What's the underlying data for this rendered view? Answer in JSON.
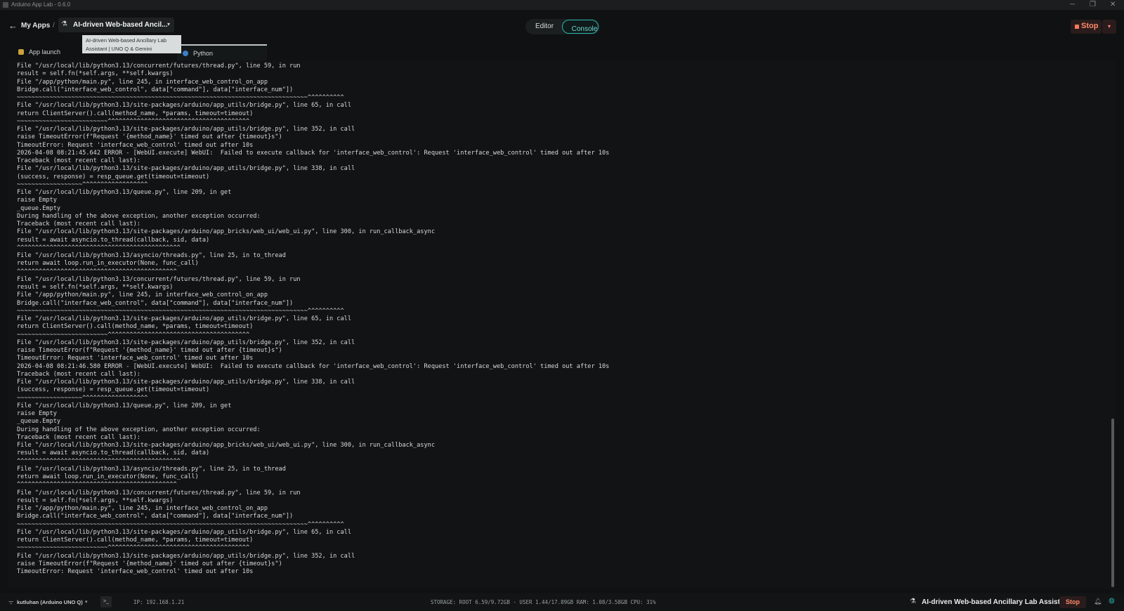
{
  "window": {
    "title": "Arduino App Lab - 0.6.0",
    "controls": [
      "─",
      "❐",
      "✕"
    ]
  },
  "header": {
    "back_icon": "←",
    "my_apps": "My Apps",
    "separator": "/",
    "app_icon": "flask-icon",
    "app_name": "AI-driven Web-based Ancil...",
    "app_caret": "▾",
    "tooltip_line1": "AI-driven Web-based Ancillary Lab",
    "tooltip_line2": "Assistant | UNO Q & Gemini",
    "view_toggle": {
      "editor": "Editor",
      "console": "Console",
      "active": "console"
    },
    "stop_label": "Stop",
    "stop_menu_icon": "▾"
  },
  "tabs": [
    {
      "label": "App launch",
      "icon": "launch-icon"
    },
    {
      "label": "Python",
      "icon": "python-icon",
      "active": true
    }
  ],
  "console": {
    "lines": [
      "File \"/usr/local/lib/python3.13/concurrent/futures/thread.py\", line 59, in run",
      "result = self.fn(*self.args, **self.kwargs)",
      "File \"/app/python/main.py\", line 245, in interface_web_control_on_app",
      "Bridge.call(\"interface_web_control\", data[\"command\"], data[\"interface_num\"])",
      "~~~~~~~~~~~~~~~~~~~~~~~~~~~~~~~~~~~~~~~~~~~~~~~~~~~~~~~~~~~~~~~~~~~~~~~~~~~~~~~~^^^^^^^^^^",
      "File \"/usr/local/lib/python3.13/site-packages/arduino/app_utils/bridge.py\", line 65, in call",
      "return ClientServer().call(method_name, *params, timeout=timeout)",
      "~~~~~~~~~~~~~~~~~~~~~~~~~^^^^^^^^^^^^^^^^^^^^^^^^^^^^^^^^^^^^^^^",
      "File \"/usr/local/lib/python3.13/site-packages/arduino/app_utils/bridge.py\", line 352, in call",
      "raise TimeoutError(f\"Request '{method_name}' timed out after {timeout}s\")",
      "TimeoutError: Request 'interface_web_control' timed out after 10s",
      "2026-04-08 08:21:45.642 ERROR - [WebUI.execute] WebUI:  Failed to execute callback for 'interface_web_control': Request 'interface_web_control' timed out after 10s",
      "Traceback (most recent call last):",
      "File \"/usr/local/lib/python3.13/site-packages/arduino/app_utils/bridge.py\", line 338, in call",
      "(success, response) = resp_queue.get(timeout=timeout)",
      "~~~~~~~~~~~~~~~~~~^^^^^^^^^^^^^^^^^^",
      "File \"/usr/local/lib/python3.13/queue.py\", line 209, in get",
      "raise Empty",
      "_queue.Empty",
      "During handling of the above exception, another exception occurred:",
      "Traceback (most recent call last):",
      "File \"/usr/local/lib/python3.13/site-packages/arduino/app_bricks/web_ui/web_ui.py\", line 300, in run_callback_async",
      "result = await asyncio.to_thread(callback, sid, data)",
      "^^^^^^^^^^^^^^^^^^^^^^^^^^^^^^^^^^^^^^^^^^^^^",
      "File \"/usr/local/lib/python3.13/asyncio/threads.py\", line 25, in to_thread",
      "return await loop.run_in_executor(None, func_call)",
      "^^^^^^^^^^^^^^^^^^^^^^^^^^^^^^^^^^^^^^^^^^^^",
      "File \"/usr/local/lib/python3.13/concurrent/futures/thread.py\", line 59, in run",
      "result = self.fn(*self.args, **self.kwargs)",
      "File \"/app/python/main.py\", line 245, in interface_web_control_on_app",
      "Bridge.call(\"interface_web_control\", data[\"command\"], data[\"interface_num\"])",
      "~~~~~~~~~~~~~~~~~~~~~~~~~~~~~~~~~~~~~~~~~~~~~~~~~~~~~~~~~~~~~~~~~~~~~~~~~~~~~~~~^^^^^^^^^^",
      "File \"/usr/local/lib/python3.13/site-packages/arduino/app_utils/bridge.py\", line 65, in call",
      "return ClientServer().call(method_name, *params, timeout=timeout)",
      "~~~~~~~~~~~~~~~~~~~~~~~~~^^^^^^^^^^^^^^^^^^^^^^^^^^^^^^^^^^^^^^^",
      "File \"/usr/local/lib/python3.13/site-packages/arduino/app_utils/bridge.py\", line 352, in call",
      "raise TimeoutError(f\"Request '{method_name}' timed out after {timeout}s\")",
      "TimeoutError: Request 'interface_web_control' timed out after 10s",
      "2026-04-08 08:21:46.580 ERROR - [WebUI.execute] WebUI:  Failed to execute callback for 'interface_web_control': Request 'interface_web_control' timed out after 10s",
      "Traceback (most recent call last):",
      "File \"/usr/local/lib/python3.13/site-packages/arduino/app_utils/bridge.py\", line 338, in call",
      "(success, response) = resp_queue.get(timeout=timeout)",
      "~~~~~~~~~~~~~~~~~~^^^^^^^^^^^^^^^^^^",
      "File \"/usr/local/lib/python3.13/queue.py\", line 209, in get",
      "raise Empty",
      "_queue.Empty",
      "During handling of the above exception, another exception occurred:",
      "Traceback (most recent call last):",
      "File \"/usr/local/lib/python3.13/site-packages/arduino/app_bricks/web_ui/web_ui.py\", line 300, in run_callback_async",
      "result = await asyncio.to_thread(callback, sid, data)",
      "^^^^^^^^^^^^^^^^^^^^^^^^^^^^^^^^^^^^^^^^^^^^^",
      "File \"/usr/local/lib/python3.13/asyncio/threads.py\", line 25, in to_thread",
      "return await loop.run_in_executor(None, func_call)",
      "^^^^^^^^^^^^^^^^^^^^^^^^^^^^^^^^^^^^^^^^^^^^",
      "File \"/usr/local/lib/python3.13/concurrent/futures/thread.py\", line 59, in run",
      "result = self.fn(*self.args, **self.kwargs)",
      "File \"/app/python/main.py\", line 245, in interface_web_control_on_app",
      "Bridge.call(\"interface_web_control\", data[\"command\"], data[\"interface_num\"])",
      "~~~~~~~~~~~~~~~~~~~~~~~~~~~~~~~~~~~~~~~~~~~~~~~~~~~~~~~~~~~~~~~~~~~~~~~~~~~~~~~~^^^^^^^^^^",
      "File \"/usr/local/lib/python3.13/site-packages/arduino/app_utils/bridge.py\", line 65, in call",
      "return ClientServer().call(method_name, *params, timeout=timeout)",
      "~~~~~~~~~~~~~~~~~~~~~~~~~^^^^^^^^^^^^^^^^^^^^^^^^^^^^^^^^^^^^^^^",
      "File \"/usr/local/lib/python3.13/site-packages/arduino/app_utils/bridge.py\", line 352, in call",
      "raise TimeoutError(f\"Request '{method_name}' timed out after {timeout}s\")",
      "TimeoutError: Request 'interface_web_control' timed out after 10s"
    ]
  },
  "statusbar": {
    "wifi_icon": "wifi-icon",
    "device": "kutluhan (Arduino UNO Q)",
    "device_caret": "▾",
    "terminal_icon": ">_",
    "ip": "IP: 192.168.1.21",
    "storage": "STORAGE: ROOT 6.59/9.72GB - USER 1.44/17.89GB   RAM: 1.08/3.58GB   CPU: 31%",
    "app_name": "AI-driven Web-based Ancillary Lab Assist...",
    "stop_label": "Stop"
  },
  "colors": {
    "accent": "#2bb3ad",
    "stop": "#ff8a6b",
    "background": "#0f1112"
  }
}
